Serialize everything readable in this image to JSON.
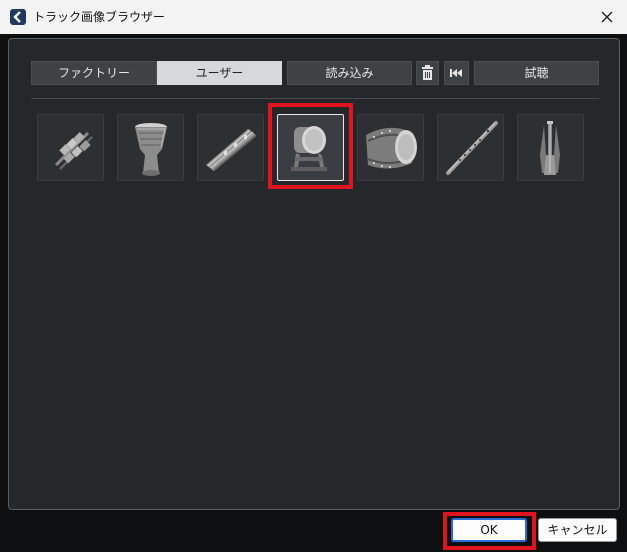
{
  "window": {
    "title": "トラック画像ブラウザー"
  },
  "tabs": [
    {
      "label": "ファクトリー",
      "active": false
    },
    {
      "label": "ユーザー",
      "active": true
    }
  ],
  "toolbar": {
    "import_label": "読み込み",
    "delete_icon": "trash-icon",
    "rewind_icon": "skip-back-icon",
    "audition_label": "試聴"
  },
  "images": [
    {
      "icon": "rattle-icon",
      "selected": false
    },
    {
      "icon": "hand-drum-icon",
      "selected": false
    },
    {
      "icon": "koto-icon",
      "selected": false
    },
    {
      "icon": "taiko-drum-on-stand-icon",
      "selected": true
    },
    {
      "icon": "barrel-drum-icon",
      "selected": false
    },
    {
      "icon": "flute-icon",
      "selected": false
    },
    {
      "icon": "shamisen-icon",
      "selected": false
    }
  ],
  "footer": {
    "ok_label": "OK",
    "cancel_label": "キャンセル"
  },
  "colors": {
    "highlight": "#e0141e",
    "panel_bg": "#25282b",
    "accent": "#2b6cd6"
  }
}
